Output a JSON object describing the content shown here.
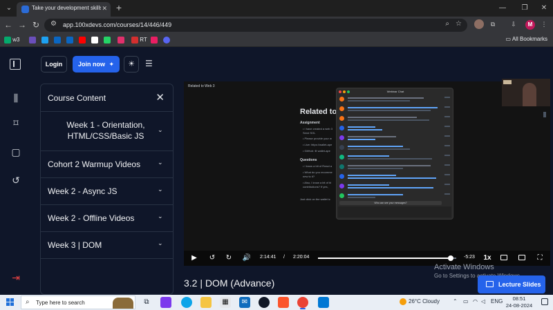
{
  "browser": {
    "tab_title": "Take your development skills fr",
    "url": "app.100xdevs.com/courses/14/446/449",
    "profile_initial": "M",
    "bookmarks": [
      {
        "label": "w3",
        "color": "#04aa6d"
      },
      {
        "label": "",
        "color": "#6b4fbb"
      },
      {
        "label": "",
        "color": "#1da1f2"
      },
      {
        "label": "",
        "color": "#0a66c2"
      },
      {
        "label": "",
        "color": "#ff0000"
      },
      {
        "label": "",
        "color": "#ffffff"
      },
      {
        "label": "",
        "color": "#25d366"
      },
      {
        "label": "",
        "color": "#e1306c"
      },
      {
        "label": "RT",
        "color": "#d32f2f"
      },
      {
        "label": "",
        "color": "#5865f2"
      }
    ],
    "all_bookmarks": "All Bookmarks"
  },
  "header": {
    "login": "Login",
    "join_now": "Join now"
  },
  "course_panel": {
    "title": "Course Content",
    "items": [
      {
        "label": "Week 1 - Orientation, HTML/CSS/Basic JS"
      },
      {
        "label": "Cohort 2 Warmup Videos"
      },
      {
        "label": "Week 2 - Async JS"
      },
      {
        "label": "Week 2 - Offline Videos"
      },
      {
        "label": "Week 3 | DOM"
      }
    ]
  },
  "video": {
    "breadcrumb": "Related to Web 3",
    "slide_heading": "Related to",
    "slide_assignment": "Assignment",
    "slide_lines": [
      "• I have created a web 3",
      "  Send SOL",
      "• Please provide your w",
      "• Live: https://wallet-ape",
      "• GitHub: ⊕ wallet-ape"
    ],
    "slide_questions": "Questions",
    "question_lines": [
      "• I know a bit of React a",
      "• What do you recomme",
      "  new to it?",
      "• Also, I know a bit of bl",
      "  contributions? If yes,"
    ],
    "slide_footer": "Just click on the wallet ic",
    "chat_title": "Webinar Chat",
    "chat_banner": "Who can see your messages?",
    "elapsed": "2:14:41",
    "separator": "/",
    "duration": "2:20:04",
    "remaining": "-5:23",
    "speed": "1x",
    "progress": 0.96
  },
  "lecture": {
    "title": "3.2 | DOM (Advance)",
    "slides_button": "Lecture Slides"
  },
  "watermark": {
    "title": "Activate Windows",
    "subtitle": "Go to Settings to activate Windows."
  },
  "taskbar": {
    "search_placeholder": "Type here to search",
    "weather": "26°C  Cloudy",
    "language": "ENG",
    "time": "08:51",
    "date": "24-08-2024"
  }
}
